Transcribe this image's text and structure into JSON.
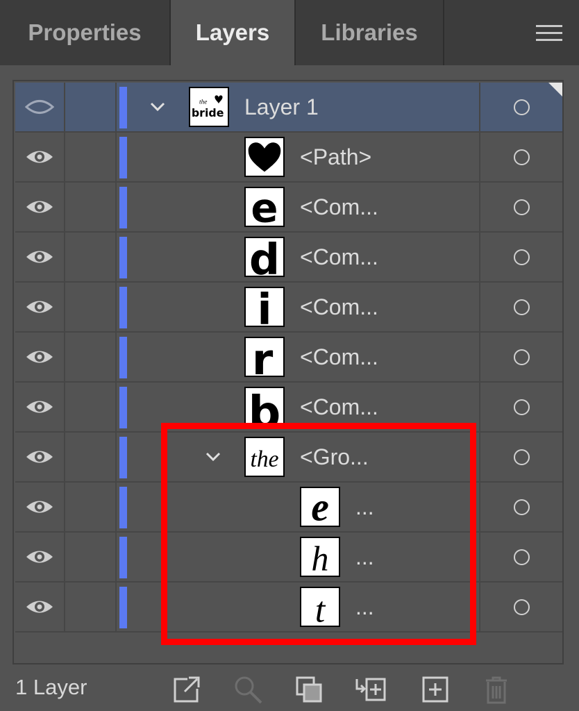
{
  "tabs": {
    "properties": "Properties",
    "layers": "Layers",
    "libraries": "Libraries"
  },
  "menu_icon": "hamburger-menu-icon",
  "layers": [
    {
      "name": "Layer 1",
      "thumb": "the-bride",
      "level": 0,
      "expanded": true,
      "selected": true
    },
    {
      "name": "<Path>",
      "thumb": "heart",
      "level": 1
    },
    {
      "name": "<Com...",
      "thumb": "letter-e",
      "level": 1
    },
    {
      "name": "<Com...",
      "thumb": "letter-d",
      "level": 1
    },
    {
      "name": "<Com...",
      "thumb": "letter-i",
      "level": 1
    },
    {
      "name": "<Com...",
      "thumb": "letter-r",
      "level": 1
    },
    {
      "name": "<Com...",
      "thumb": "letter-b",
      "level": 1
    },
    {
      "name": "<Gro...",
      "thumb": "script-the",
      "level": 1,
      "expanded": true
    },
    {
      "name": "...",
      "thumb": "script-e",
      "level": 2
    },
    {
      "name": "...",
      "thumb": "script-h",
      "level": 2
    },
    {
      "name": "...",
      "thumb": "script-t",
      "level": 2
    }
  ],
  "thumb_text": {
    "the_bride_top": "the",
    "the_bride_bottom": "bride",
    "e": "e",
    "d": "d",
    "i": "i",
    "r": "r",
    "b": "b",
    "script_the": "the",
    "script_e": "e",
    "script_h": "h",
    "script_t": "t"
  },
  "footer": {
    "layer_count": "1 Layer",
    "icons": [
      "export-for-screens-icon",
      "locate-object-icon",
      "make-clipping-mask-icon",
      "create-sublayer-icon",
      "create-new-layer-icon",
      "delete-icon"
    ]
  },
  "colors": {
    "panel_bg": "#535353",
    "tab_bar_bg": "#3c3c3c",
    "selected_row": "#4c5b75",
    "layer_color": "#5b7af2",
    "highlight": "#ff0000"
  }
}
